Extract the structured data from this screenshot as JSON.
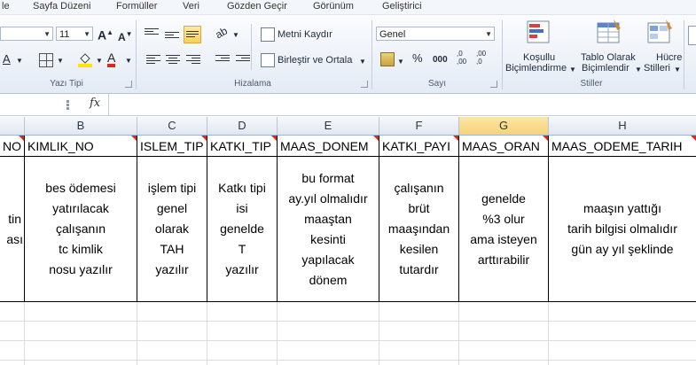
{
  "menu": {
    "items": [
      "le",
      "Sayfa Düzeni",
      "Formüller",
      "Veri",
      "Gözden Geçir",
      "Görünüm",
      "Geliştirici"
    ]
  },
  "ribbon": {
    "font_size": "11",
    "font_grow": "A",
    "font_shrink": "A",
    "underline_btn": "A",
    "font_color_btn": "A",
    "metni_kaydir": "Metni Kaydır",
    "birlestir": "Birleştir ve Ortala",
    "number_format": "Genel",
    "percent": "%",
    "comma": "000",
    "inc_decimal": ",0\n,00",
    "dec_decimal": ",00\n,0",
    "kosullu": "Koşullu",
    "kosullu2": "Biçimlendirme",
    "tablo": "Tablo Olarak",
    "tablo2": "Biçimlendir",
    "hucre": "Hücre",
    "hucre2": "Stilleri",
    "groups": {
      "yazi_tipi": "Yazı Tipi",
      "hizalama": "Hizalama",
      "sayi": "Sayı",
      "stiller": "Stiller"
    }
  },
  "formula_bar": {
    "fx": "fx",
    "value": ""
  },
  "columns": [
    {
      "letter": "",
      "header": "NO",
      "desc": [
        "tin",
        "ası"
      ]
    },
    {
      "letter": "B",
      "header": "KIMLIK_NO",
      "desc": [
        "bes ödemesi",
        "yatırılacak",
        "çalışanın",
        "tc kimlik",
        "nosu yazılır"
      ]
    },
    {
      "letter": "C",
      "header": "ISLEM_TIP",
      "desc": [
        "işlem tipi",
        "genel",
        "olarak",
        "TAH",
        "yazılır"
      ]
    },
    {
      "letter": "D",
      "header": "KATKI_TIP",
      "desc": [
        "Katkı tipi",
        "isi",
        "genelde",
        "T",
        "yazılır"
      ]
    },
    {
      "letter": "E",
      "header": "MAAS_DONEM",
      "desc": [
        "bu format",
        "ay.yıl olmalıdır",
        "maaştan",
        "kesinti",
        "yapılacak",
        "dönem"
      ]
    },
    {
      "letter": "F",
      "header": "KATKI_PAYI",
      "desc": [
        "çalışanın",
        "brüt",
        "maaşından",
        "kesilen",
        "tutardır"
      ]
    },
    {
      "letter": "G",
      "header": "MAAS_ORAN",
      "desc": [
        "genelde",
        "%3 olur",
        "ama isteyen",
        "arttırabilir"
      ]
    },
    {
      "letter": "H",
      "header": "MAAS_ODEME_TARIH",
      "desc": [
        "maaşın yattığı",
        "tarih bilgisi olmalıdır",
        "gün ay yıl şeklinde"
      ]
    }
  ],
  "colors": {
    "selected_col_header": "#f8d98a",
    "comment_marker": "#e0261c",
    "ribbon_bg": "#e4ebf5"
  }
}
